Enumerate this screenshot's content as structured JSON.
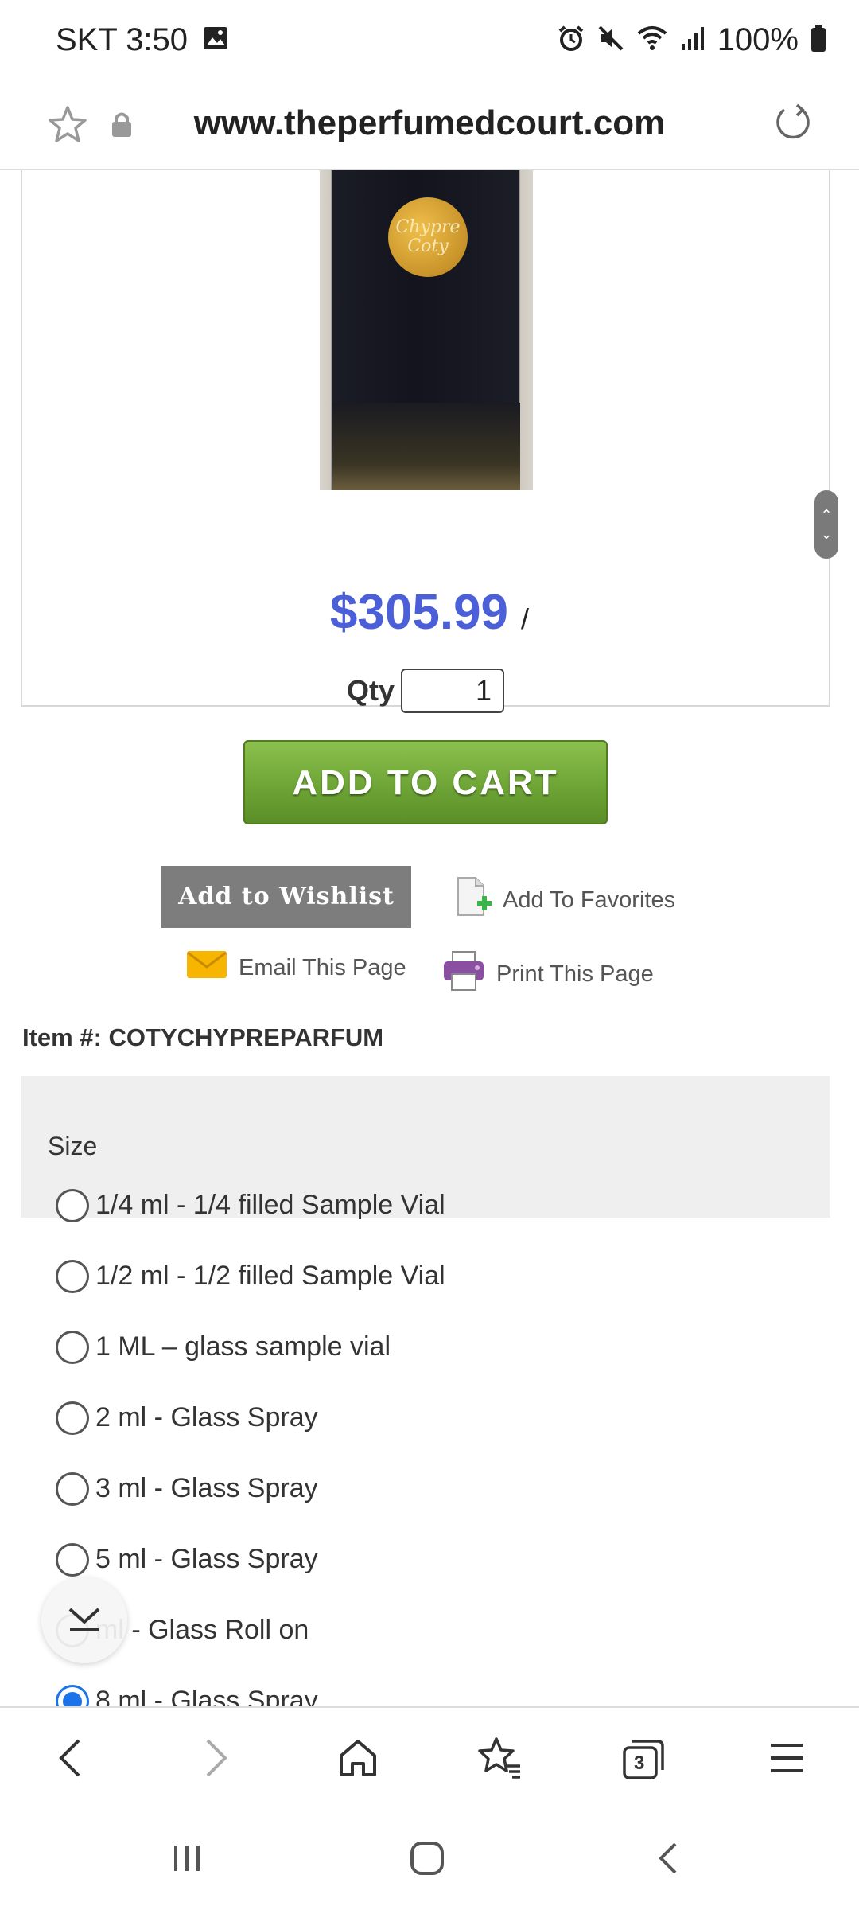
{
  "status_bar": {
    "carrier_time": "SKT 3:50",
    "battery": "100%"
  },
  "url_bar": {
    "url": "www.theperfumedcourt.com"
  },
  "product": {
    "badge_text_line1": "Chypre",
    "badge_text_line2": "Coty",
    "price": "$305.99",
    "price_suffix": "/",
    "qty_label": "Qty",
    "qty_value": "1",
    "add_to_cart_label": "ADD TO CART",
    "wishlist_label": "Add to Wishlist",
    "favorites_label": "Add To Favorites",
    "email_label": "Email This Page",
    "print_label": "Print This Page",
    "item_number": "Item #: COTYCHYPREPARFUM"
  },
  "size": {
    "title": "Size",
    "selected_index": 7,
    "options": [
      "1/4 ml - 1/4 filled Sample Vial",
      "1/2 ml - 1/2 filled Sample Vial",
      "1 ML – glass sample vial",
      "2 ml - Glass Spray",
      "3 ml - Glass Spray",
      "5 ml - Glass Spray",
      "ml - Glass Roll on",
      "8 ml - Glass Spray"
    ]
  },
  "bottom_toolbar": {
    "tabs_count": "3"
  },
  "colors": {
    "price": "#4a5fd8",
    "cart_green": "#6ea536",
    "radio_selected": "#1a73e8"
  }
}
